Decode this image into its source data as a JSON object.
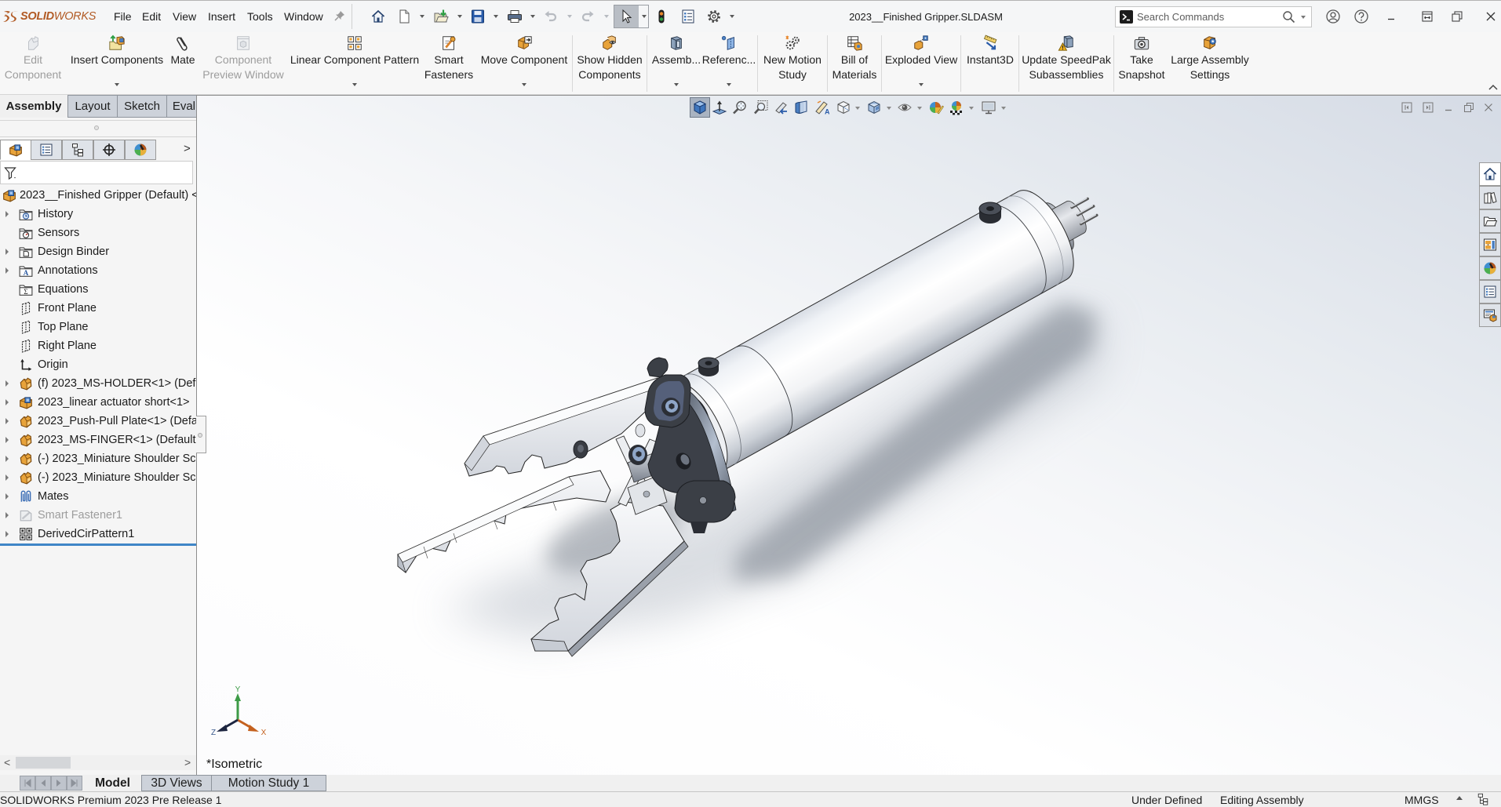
{
  "window": {
    "brand_bold": "SOLID",
    "brand_light": "WORKS",
    "menu": [
      "File",
      "Edit",
      "View",
      "Insert",
      "Tools",
      "Window"
    ],
    "document_title": "2023__Finished Gripper.SLDASM",
    "search_placeholder": "Search Commands",
    "quick_access": [
      "home-icon",
      "new-document-icon",
      "open-document-icon",
      "save-icon",
      "print-icon",
      "undo-icon",
      "redo-icon",
      "select-icon",
      "rebuild-icon",
      "file-properties-icon",
      "options-icon"
    ],
    "undo_enabled": false,
    "redo_enabled": false,
    "controls": [
      "user-account-icon",
      "help-icon",
      "minimize-icon",
      "tile-icon",
      "restore-icon",
      "close-icon"
    ]
  },
  "ribbon": {
    "items": [
      {
        "line1": "Edit",
        "line2": "Component",
        "icon": "edit-component-icon",
        "enabled": false,
        "dropdown": false
      },
      {
        "line1": "Insert Components",
        "line2": "",
        "icon": "insert-components-icon",
        "enabled": true,
        "dropdown": true
      },
      {
        "line1": "Mate",
        "line2": "",
        "icon": "mate-icon",
        "enabled": true,
        "dropdown": false
      },
      {
        "line1": "Component",
        "line2": "Preview Window",
        "icon": "component-preview-window-icon",
        "enabled": false,
        "dropdown": false
      },
      {
        "line1": "Linear Component Pattern",
        "line2": "",
        "icon": "linear-component-pattern-icon",
        "enabled": true,
        "dropdown": true
      },
      {
        "line1": "Smart",
        "line2": "Fasteners",
        "icon": "smart-fasteners-icon",
        "enabled": true,
        "dropdown": false
      },
      {
        "line1": "Move Component",
        "line2": "",
        "icon": "move-component-icon",
        "enabled": true,
        "dropdown": true
      },
      {
        "line1": "Show Hidden",
        "line2": "Components",
        "icon": "show-hidden-components-icon",
        "enabled": true,
        "dropdown": false
      },
      {
        "line1": "Assemb...",
        "line2": "",
        "icon": "assembly-features-icon",
        "enabled": true,
        "dropdown": true
      },
      {
        "line1": "Referenc...",
        "line2": "",
        "icon": "reference-geometry-icon",
        "enabled": true,
        "dropdown": true
      },
      {
        "line1": "New Motion",
        "line2": "Study",
        "icon": "new-motion-study-icon",
        "enabled": true,
        "dropdown": false
      },
      {
        "line1": "Bill of",
        "line2": "Materials",
        "icon": "bill-of-materials-icon",
        "enabled": true,
        "dropdown": false
      },
      {
        "line1": "Exploded View",
        "line2": "",
        "icon": "exploded-view-icon",
        "enabled": true,
        "dropdown": true
      },
      {
        "line1": "Instant3D",
        "line2": "",
        "icon": "instant3d-icon",
        "enabled": true,
        "dropdown": false
      },
      {
        "line1": "Update SpeedPak",
        "line2": "Subassemblies",
        "icon": "update-speedpak-icon",
        "enabled": true,
        "dropdown": false
      },
      {
        "line1": "Take",
        "line2": "Snapshot",
        "icon": "take-snapshot-icon",
        "enabled": true,
        "dropdown": false
      },
      {
        "line1": "Large Assembly",
        "line2": "Settings",
        "icon": "large-assembly-settings-icon",
        "enabled": true,
        "dropdown": false
      }
    ]
  },
  "command_tabs": [
    {
      "label": "Assembly",
      "active": true
    },
    {
      "label": "Layout",
      "active": false
    },
    {
      "label": "Sketch",
      "active": false
    },
    {
      "label": "Evaluate",
      "active": false
    }
  ],
  "feature_manager": {
    "tabs": [
      "featuremanager-tree-icon",
      "propertymanager-icon",
      "configurationmanager-icon",
      "dimxpertmanager-icon",
      "displaymanager-icon"
    ],
    "more_tabs": ">",
    "filter_icon": "filter-icon",
    "root": {
      "label": "2023__Finished Gripper (Default) <",
      "icon": "assembly-icon"
    },
    "items": [
      {
        "label": "History",
        "icon": "history-folder-icon",
        "expandable": true
      },
      {
        "label": "Sensors",
        "icon": "sensors-folder-icon",
        "expandable": false
      },
      {
        "label": "Design Binder",
        "icon": "design-binder-folder-icon",
        "expandable": true
      },
      {
        "label": "Annotations",
        "icon": "annotations-folder-icon",
        "expandable": true
      },
      {
        "label": "Equations",
        "icon": "equations-folder-icon",
        "expandable": false
      },
      {
        "label": "Front Plane",
        "icon": "plane-icon",
        "expandable": false
      },
      {
        "label": "Top Plane",
        "icon": "plane-icon",
        "expandable": false
      },
      {
        "label": "Right Plane",
        "icon": "plane-icon",
        "expandable": false
      },
      {
        "label": "Origin",
        "icon": "origin-icon",
        "expandable": false
      },
      {
        "label": "(f) 2023_MS-HOLDER<1> (Def",
        "icon": "part-icon",
        "expandable": true
      },
      {
        "label": "2023_linear actuator short<1>",
        "icon": "subassembly-icon",
        "expandable": true
      },
      {
        "label": "2023_Push-Pull Plate<1> (Defa",
        "icon": "part-icon",
        "expandable": true
      },
      {
        "label": "2023_MS-FINGER<1> (Default",
        "icon": "part-icon",
        "expandable": true
      },
      {
        "label": "(-) 2023_Miniature Shoulder Sc",
        "icon": "part-icon",
        "expandable": true
      },
      {
        "label": "(-) 2023_Miniature Shoulder Sc",
        "icon": "part-icon",
        "expandable": true
      },
      {
        "label": "Mates",
        "icon": "mates-icon",
        "expandable": true
      },
      {
        "label": "Smart Fastener1",
        "icon": "smart-fastener-icon",
        "expandable": true,
        "suppressed": true
      },
      {
        "label": "DerivedCirPattern1",
        "icon": "derived-circular-pattern-icon",
        "expandable": true
      }
    ],
    "scroll_left": "<",
    "scroll_right": ">"
  },
  "viewport": {
    "view_name": "*Isometric",
    "triad": {
      "x": "X",
      "y": "Y",
      "z": "Z"
    },
    "heads_up_toolbar": [
      "view-cube-icon",
      "normal-to-icon",
      "zoom-to-fit-icon",
      "zoom-to-area-icon",
      "previous-view-icon",
      "section-view-icon",
      "dynamic-annotation-views-icon",
      "view-orientation-icon",
      "display-style-icon",
      "hide-show-items-icon",
      "edit-appearance-icon",
      "apply-scene-icon",
      "view-settings-icon"
    ],
    "task_pane": [
      "resources-home-icon",
      "design-library-icon",
      "file-explorer-icon",
      "view-palette-icon",
      "appearances-scenes-icon",
      "custom-properties-icon",
      "community-forum-icon"
    ],
    "model": "2023__Finished Gripper assembly (isometric)"
  },
  "bottom_tabs": [
    {
      "label": "Model",
      "active": true
    },
    {
      "label": "3D Views",
      "active": false
    },
    {
      "label": "Motion Study 1",
      "active": false
    }
  ],
  "status_bar": {
    "product": "SOLIDWORKS Premium 2023 Pre Release 1",
    "definition": "Under Defined",
    "mode": "Editing Assembly",
    "units": "MMGS"
  },
  "colors": {
    "brand": "#b15a24",
    "rollback_bar": "#3f86c7",
    "part_orange": "#e8a33a",
    "disabled_text": "#9d9d9d",
    "triad_x": "#c4611f",
    "triad_y": "#3d9b47",
    "triad_z": "#1d2540"
  }
}
